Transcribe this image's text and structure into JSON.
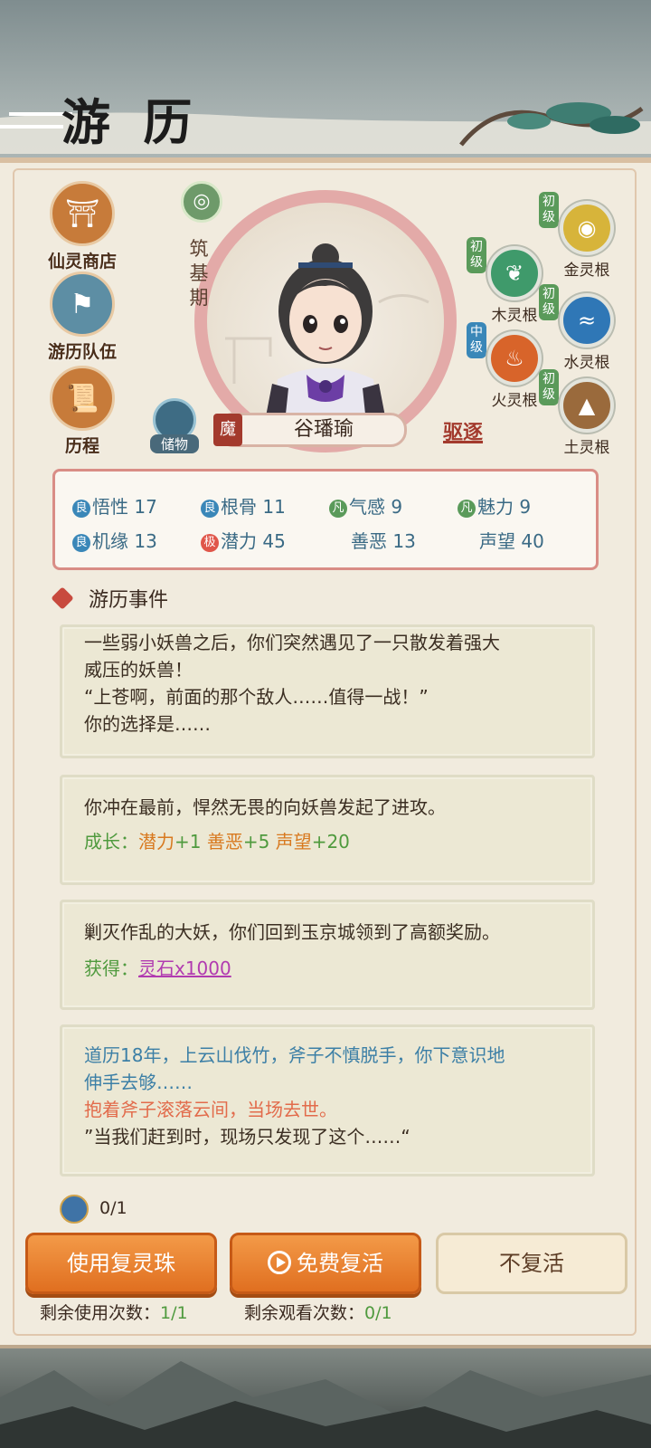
{
  "header": {
    "title_big": "游",
    "title_small": "历"
  },
  "menu": [
    {
      "label": "仙灵商店",
      "icon": "shop-icon"
    },
    {
      "label": "游历队伍",
      "icon": "team-icon"
    },
    {
      "label": "历程",
      "icon": "scroll-icon"
    }
  ],
  "character": {
    "realm": "筑基期",
    "name": "谷璠瑜",
    "seal": "魔",
    "expel_label": "驱逐",
    "storage_label": "储物"
  },
  "spirit_roots": [
    {
      "grade": "初级",
      "label": "金灵根",
      "color": "#d7b43a"
    },
    {
      "grade": "初级",
      "label": "木灵根",
      "color": "#3f9a6b"
    },
    {
      "grade": "初级",
      "label": "水灵根",
      "color": "#2f77b6"
    },
    {
      "grade": "中级",
      "label": "火灵根",
      "color": "#d8642a"
    },
    {
      "grade": "初级",
      "label": "土灵根",
      "color": "#9a6a3c"
    }
  ],
  "attributes": [
    {
      "tag": "良",
      "name": "悟性",
      "value": "17"
    },
    {
      "tag": "良",
      "name": "根骨",
      "value": "11"
    },
    {
      "tag": "凡",
      "name": "气感",
      "value": "9"
    },
    {
      "tag": "凡",
      "name": "魅力",
      "value": "9"
    },
    {
      "tag": "良",
      "name": "机缘",
      "value": "13"
    },
    {
      "tag": "极",
      "name": "潜力",
      "value": "45"
    },
    {
      "tag": "",
      "name": "善恶",
      "value": "13"
    },
    {
      "tag": "",
      "name": "声望",
      "value": "40"
    }
  ],
  "events": {
    "heading": "游历事件",
    "card1": {
      "line1": "一些弱小妖兽之后，你们突然遇见了一只散发着强大",
      "line2": "威压的妖兽！",
      "line3": "“上苍啊，前面的那个敌人……值得一战！”",
      "line4": "你的选择是……"
    },
    "card2": {
      "text": "你冲在最前，悍然无畏的向妖兽发起了进攻。",
      "growth_label": "成长：",
      "growth": [
        {
          "name": "潜力",
          "delta": "+1"
        },
        {
          "name": "善恶",
          "delta": "+5"
        },
        {
          "name": "声望",
          "delta": "+20"
        }
      ]
    },
    "card3": {
      "text": "剿灭作乱的大妖，你们回到玉京城领到了高额奖励。",
      "reward_label": "获得：",
      "reward": "灵石x1000"
    },
    "card4": {
      "line1": "道历18年，上云山伐竹，斧子不慎脱手，你下意识地",
      "line2": "伸手去够……",
      "line3": "抱着斧子滚落云间，当场去世。",
      "line4": "”当我们赶到时，现场只发现了这个……“"
    }
  },
  "revive": {
    "pearl_count": "0/1",
    "btn_use": "使用复灵珠",
    "btn_free": "免费复活",
    "btn_no": "不复活",
    "remain_use_label": "剩余使用次数：",
    "remain_use_value": "1/1",
    "remain_watch_label": "剩余观看次数：",
    "remain_watch_value": "0/1"
  }
}
